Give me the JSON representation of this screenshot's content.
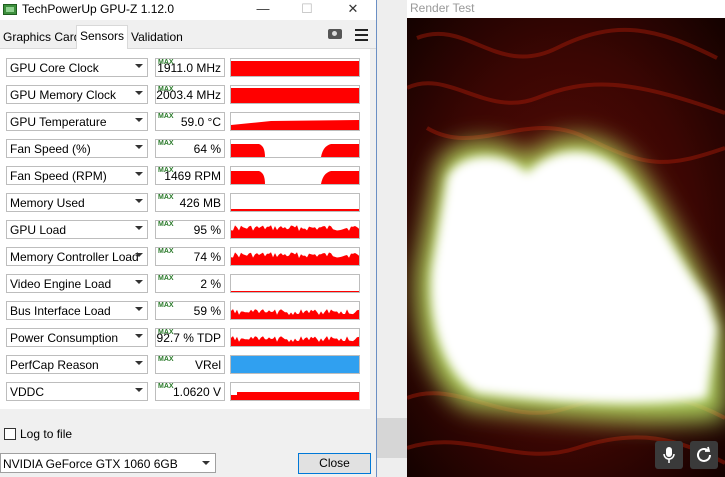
{
  "window": {
    "title": "TechPowerUp GPU-Z 1.12.0",
    "minimize_glyph": "—",
    "maximize_glyph": "☐",
    "close_glyph": "✕"
  },
  "tabs": [
    {
      "label": "Graphics Card"
    },
    {
      "label": "Sensors",
      "active": true
    },
    {
      "label": "Validation"
    }
  ],
  "toolbar": {
    "camera_icon": "camera-icon",
    "menu_icon": "hamburger-menu-icon"
  },
  "max_tag": "MAX",
  "sensors": [
    {
      "label": "GPU Core Clock",
      "value": "1911.0 MHz",
      "graph": "full"
    },
    {
      "label": "GPU Memory Clock",
      "value": "2003.4 MHz",
      "graph": "full"
    },
    {
      "label": "GPU Temperature",
      "value": "59.0 °C",
      "graph": "temp"
    },
    {
      "label": "Fan Speed (%)",
      "value": "64 %",
      "graph": "fan"
    },
    {
      "label": "Fan Speed (RPM)",
      "value": "1469 RPM",
      "graph": "fan"
    },
    {
      "label": "Memory Used",
      "value": "426 MB",
      "graph": "line"
    },
    {
      "label": "GPU Load",
      "value": "95 %",
      "graph": "noisy"
    },
    {
      "label": "Memory Controller Load",
      "value": "74 %",
      "graph": "noisy"
    },
    {
      "label": "Video Engine Load",
      "value": "2 %",
      "graph": "empty"
    },
    {
      "label": "Bus Interface Load",
      "value": "59 %",
      "graph": "noisy-low"
    },
    {
      "label": "Power Consumption",
      "value": "92.7 % TDP",
      "graph": "noisy-low"
    },
    {
      "label": "PerfCap Reason",
      "value": "VRel",
      "graph": "blue"
    },
    {
      "label": "VDDC",
      "value": "1.0620 V",
      "graph": "vddc"
    }
  ],
  "log_to_file": {
    "label": "Log to file",
    "checked": false
  },
  "gpu_select": {
    "value": "NVIDIA GeForce GTX 1060 6GB"
  },
  "close_button": {
    "label": "Close"
  },
  "render_window": {
    "title": "Render Test"
  },
  "colors": {
    "graph_red": "#ff0000",
    "perfcap_blue": "#30a0f0",
    "accent": "#0078d7"
  }
}
